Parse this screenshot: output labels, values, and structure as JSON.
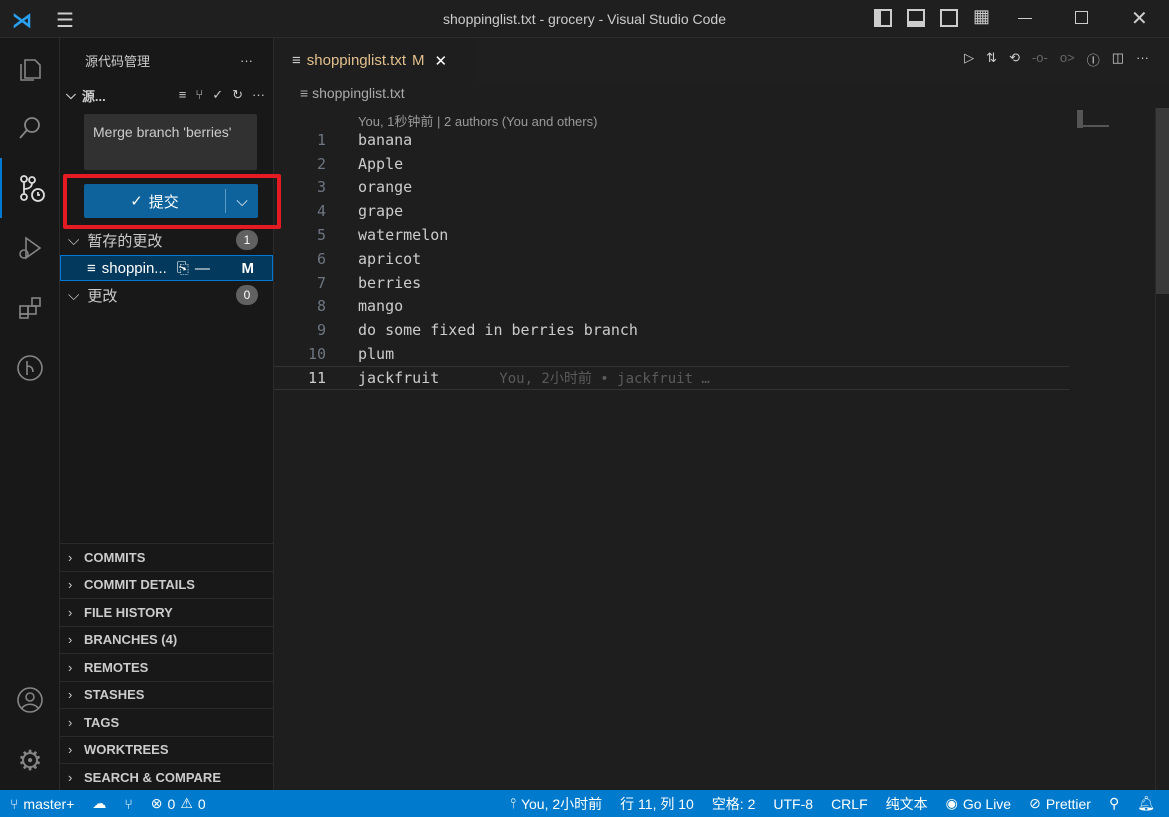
{
  "window": {
    "title": "shoppinglist.txt - grocery - Visual Studio Code"
  },
  "sidebar": {
    "title": "源代码管理",
    "repo": "源...",
    "commit_message": "Merge branch 'berries'",
    "commit_button": "提交",
    "staged": {
      "label": "暂存的更改",
      "count": "1"
    },
    "staged_file": {
      "name": "shoppin...",
      "status": "M"
    },
    "changes": {
      "label": "更改",
      "count": "0"
    },
    "panels": [
      "COMMITS",
      "COMMIT DETAILS",
      "FILE HISTORY",
      "BRANCHES (4)",
      "REMOTES",
      "STASHES",
      "TAGS",
      "WORKTREES",
      "SEARCH & COMPARE"
    ]
  },
  "editor": {
    "tab": {
      "name": "shoppinglist.txt",
      "status": "M"
    },
    "breadcrumb": "shoppinglist.txt",
    "codelens": "You, 1秒钟前 | 2 authors (You and others)",
    "lines": [
      "banana",
      "Apple",
      "orange",
      "grape",
      "watermelon",
      "apricot",
      "berries",
      "mango",
      "do some fixed in berries branch",
      "plum",
      "jackfruit"
    ],
    "blame": "You, 2小时前 • jackfruit …"
  },
  "status": {
    "branch": "master+",
    "errors": "0",
    "warnings": "0",
    "blame": "You, 2小时前",
    "position": "行 11, 列 10",
    "spaces": "空格: 2",
    "encoding": "UTF-8",
    "eol": "CRLF",
    "language": "纯文本",
    "golive": "Go Live",
    "prettier": "Prettier"
  }
}
